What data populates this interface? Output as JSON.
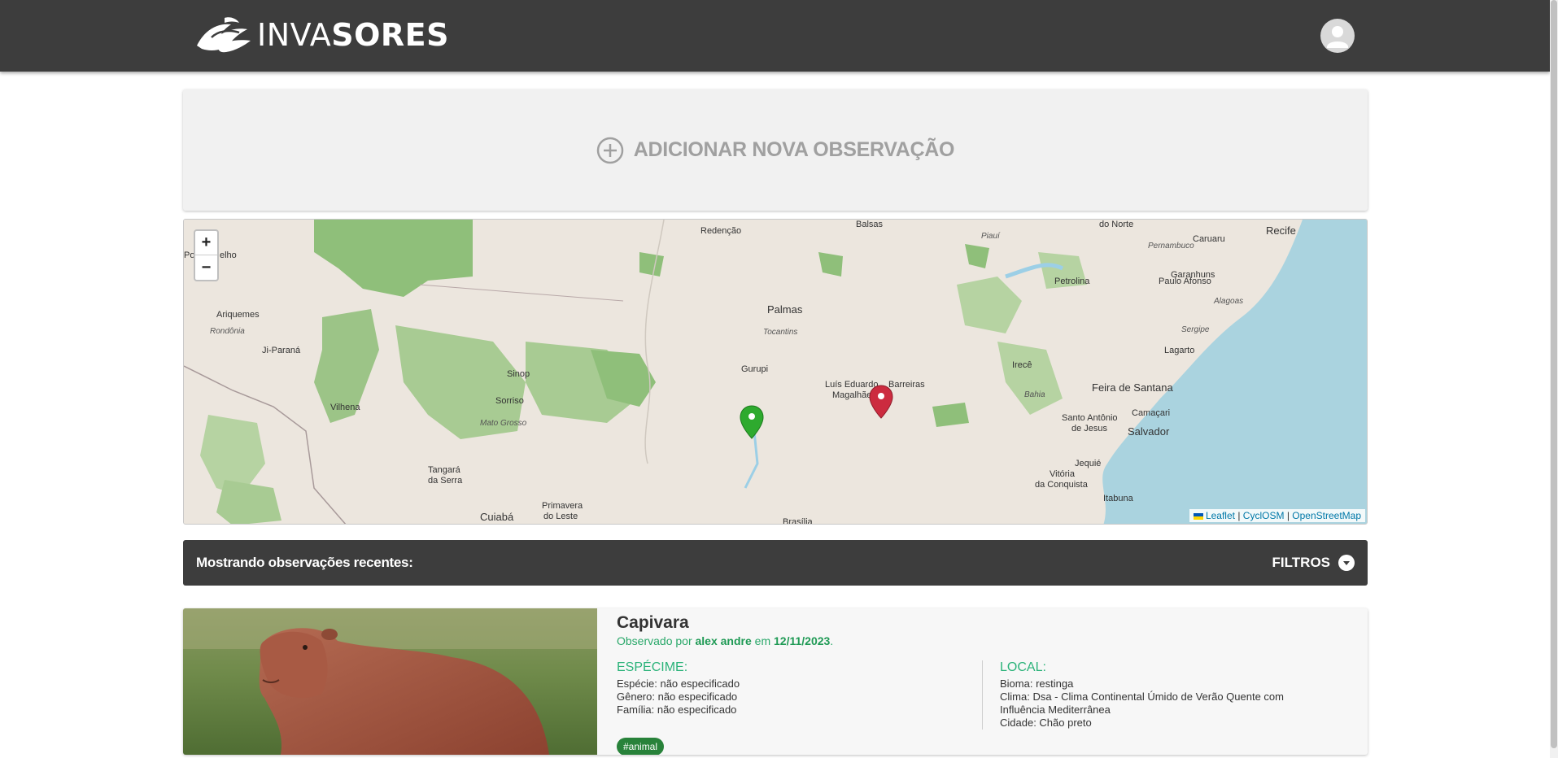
{
  "header": {
    "logo_light": "INVA",
    "logo_bold": "SORES",
    "logo_icon": "birds-logo-icon",
    "avatar_icon": "user-icon"
  },
  "add_observation": {
    "label": "ADICIONAR NOVA OBSERVAÇÃO",
    "icon": "plus-circle-icon"
  },
  "map": {
    "zoom_in": "+",
    "zoom_out": "−",
    "attribution": {
      "leaflet": "Leaflet",
      "sep1": "|",
      "cyclosm": "CyclOSM",
      "sep2": "|",
      "osm": "OpenStreetMap"
    },
    "places": [
      {
        "name": "Redenção",
        "style": "normal"
      },
      {
        "name": "Balsas",
        "style": "normal"
      },
      {
        "name": "Piauí",
        "style": "italic"
      },
      {
        "name": "do Norte",
        "style": "normal"
      },
      {
        "name": "Caruaru",
        "style": "normal"
      },
      {
        "name": "Recife",
        "style": "big"
      },
      {
        "name": "Pernambuco",
        "style": "italic"
      },
      {
        "name": "Garanhuns",
        "style": "normal"
      },
      {
        "name": "Petrolina",
        "style": "normal"
      },
      {
        "name": "Paulo Afonso",
        "style": "normal"
      },
      {
        "name": "Alagoas",
        "style": "italic"
      },
      {
        "name": "Po",
        "style": "normal"
      },
      {
        "name": "elho",
        "style": "normal"
      },
      {
        "name": "Ariquemes",
        "style": "normal"
      },
      {
        "name": "Rondônia",
        "style": "italic"
      },
      {
        "name": "Ji-Paraná",
        "style": "normal"
      },
      {
        "name": "Palmas",
        "style": "big"
      },
      {
        "name": "Tocantins",
        "style": "italic"
      },
      {
        "name": "Sergipe",
        "style": "italic"
      },
      {
        "name": "Lagarto",
        "style": "normal"
      },
      {
        "name": "Irecê",
        "style": "normal"
      },
      {
        "name": "Gurupi",
        "style": "normal"
      },
      {
        "name": "Luís Eduardo",
        "style": "normal"
      },
      {
        "name": "Magalhães",
        "style": "normal"
      },
      {
        "name": "Barreiras",
        "style": "normal"
      },
      {
        "name": "Sinop",
        "style": "normal"
      },
      {
        "name": "Feira de Santana",
        "style": "big"
      },
      {
        "name": "Bahia",
        "style": "italic"
      },
      {
        "name": "Camaçari",
        "style": "normal"
      },
      {
        "name": "Vilhena",
        "style": "normal"
      },
      {
        "name": "Sorriso",
        "style": "normal"
      },
      {
        "name": "Mato Grosso",
        "style": "italic"
      },
      {
        "name": "Santo Antônio",
        "style": "normal"
      },
      {
        "name": "de Jesus",
        "style": "normal"
      },
      {
        "name": "Salvador",
        "style": "big"
      },
      {
        "name": "Jequié",
        "style": "normal"
      },
      {
        "name": "Tangará",
        "style": "normal"
      },
      {
        "name": "da Serra",
        "style": "normal"
      },
      {
        "name": "Vitória",
        "style": "normal"
      },
      {
        "name": "da Conquista",
        "style": "normal"
      },
      {
        "name": "Itabuna",
        "style": "normal"
      },
      {
        "name": "Primavera",
        "style": "normal"
      },
      {
        "name": "do Leste",
        "style": "normal"
      },
      {
        "name": "Cuiabá",
        "style": "big"
      },
      {
        "name": "Brasília",
        "style": "normal"
      }
    ],
    "markers": [
      {
        "color": "#2eaa2e",
        "icon": "location-pin-icon"
      },
      {
        "color": "#cc2b3f",
        "icon": "location-pin-icon"
      }
    ]
  },
  "observations_bar": {
    "title": "Mostrando observações recentes:",
    "filters_label": "FILTROS",
    "filters_icon": "chevron-down-icon"
  },
  "observations": [
    {
      "name": "Capivara",
      "meta_prefix": "Observado por",
      "author": "alex andre",
      "meta_mid": "em",
      "date": "12/11/2023",
      "meta_suffix": ".",
      "specimen_title": "ESPÉCIME:",
      "species": "Espécie: não especificado",
      "genus": "Gênero: não especificado",
      "family": "Família: não especificado",
      "location_title": "LOCAL:",
      "biome": "Bioma: restinga",
      "climate": "Clima: Dsa - Clima Continental Úmido de Verão Quente com Influência Mediterrânea",
      "city": "Cidade: Chão preto",
      "tag": "#animal"
    }
  ]
}
